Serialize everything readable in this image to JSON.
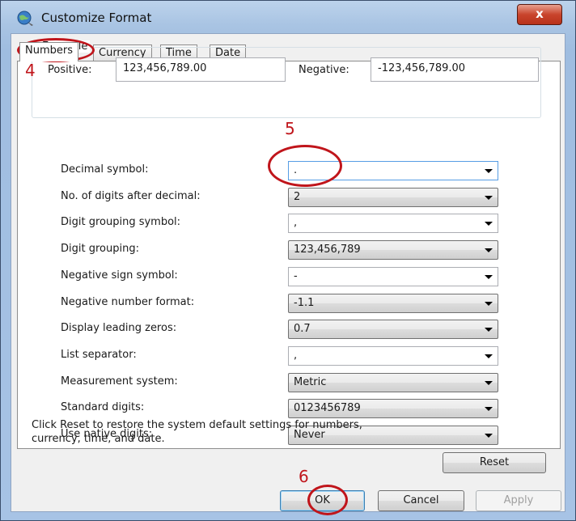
{
  "window": {
    "title": "Customize Format",
    "close_label": "x"
  },
  "tabs": [
    {
      "label": "Numbers",
      "active": true
    },
    {
      "label": "Currency",
      "active": false
    },
    {
      "label": "Time",
      "active": false
    },
    {
      "label": "Date",
      "active": false
    }
  ],
  "example": {
    "legend": "Example",
    "positive_label": "Positive:",
    "positive_value": "123,456,789.00",
    "negative_label": "Negative:",
    "negative_value": "-123,456,789.00"
  },
  "settings": [
    {
      "label": "Decimal symbol:",
      "value": ".",
      "editable": true
    },
    {
      "label": "No. of digits after decimal:",
      "value": "2",
      "editable": false
    },
    {
      "label": "Digit grouping symbol:",
      "value": ",",
      "editable": true
    },
    {
      "label": "Digit grouping:",
      "value": "123,456,789",
      "editable": false
    },
    {
      "label": "Negative sign symbol:",
      "value": "-",
      "editable": true
    },
    {
      "label": "Negative number format:",
      "value": "-1.1",
      "editable": false
    },
    {
      "label": "Display leading zeros:",
      "value": "0.7",
      "editable": false
    },
    {
      "label": "List separator:",
      "value": ",",
      "editable": true
    },
    {
      "label": "Measurement system:",
      "value": "Metric",
      "editable": false
    },
    {
      "label": "Standard digits:",
      "value": "0123456789",
      "editable": false
    },
    {
      "label": "Use native digits:",
      "value": "Never",
      "editable": false
    }
  ],
  "reset_note": "Click Reset to restore the system default settings for numbers, currency, time, and date.",
  "buttons": {
    "reset": "Reset",
    "ok": "OK",
    "cancel": "Cancel",
    "apply": "Apply"
  },
  "annotations": {
    "step_tab": "4",
    "step_decimal": "5",
    "step_ok": "6",
    "color": "#c0151b"
  },
  "icons": {
    "app": "globe-icon",
    "close": "close-icon",
    "dropdown": "chevron-down-icon"
  }
}
